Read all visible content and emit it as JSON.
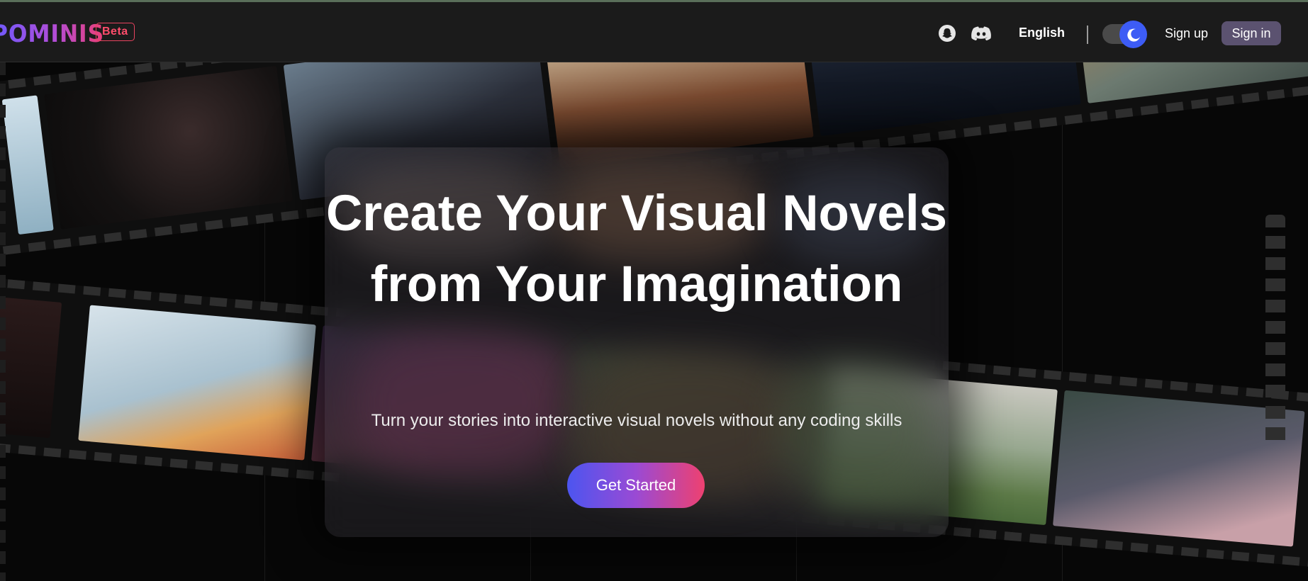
{
  "header": {
    "logo_text": "POMINIS",
    "beta_label": "Beta",
    "language": "English",
    "signup_label": "Sign up",
    "signin_label": "Sign in",
    "icons": [
      "snapchat-ghost-icon",
      "discord-icon",
      "moon-icon"
    ]
  },
  "hero": {
    "title": "Create Your Visual Novels from Your Imagination",
    "subtitle": "Turn your stories into interactive visual novels without any coding skills",
    "cta_label": "Get Started"
  },
  "colors": {
    "accent_blue": "#3d5cf5",
    "brand_gradient_start": "#6b5bff",
    "brand_gradient_end": "#ec3f76",
    "beta_red": "#e8435f",
    "signin_bg": "#5b5270"
  }
}
